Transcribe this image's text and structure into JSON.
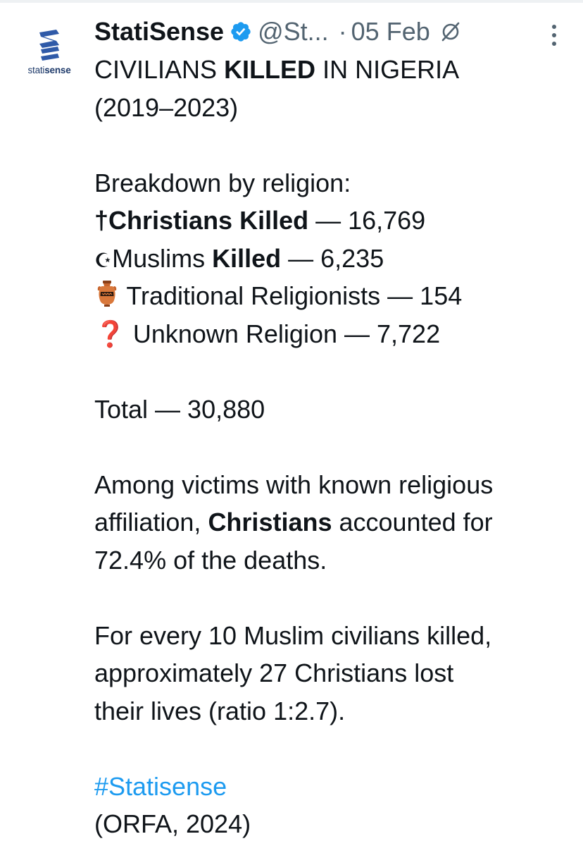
{
  "author": {
    "avatar_brand": "statisense",
    "avatar_brand_prefix": "stati",
    "avatar_brand_suffix": "sense",
    "name": "StatiSense",
    "handle": "@St...",
    "date": "05 Feb",
    "verified_icon": "verified-badge-icon",
    "grok_icon": "grok-icon",
    "more_icon": "more-vertical-icon"
  },
  "tweet": {
    "title_pre": "CIVILIANS ",
    "title_bold": "KILLED",
    "title_post": " IN NIGERIA",
    "years": "(2019–2023)",
    "breakdown_heading": "Breakdown by religion:",
    "items": [
      {
        "icon": "cross-icon",
        "glyph": "†",
        "bold": "Christians Killed",
        "text": " — 16,769"
      },
      {
        "icon": "crescent-icon",
        "glyph": "☪",
        "plain": "Muslims ",
        "bold": "Killed",
        "text": " — 6,235"
      },
      {
        "icon": "amphora-icon",
        "text": " Traditional Religionists — 154"
      },
      {
        "icon": "red-question-icon",
        "glyph": "❓",
        "text": " Unknown Religion — 7,722"
      }
    ],
    "total": "Total — 30,880",
    "para1_l1": "Among victims with known religious",
    "para1_l2_pre": "affiliation, ",
    "para1_l2_bold": "Christians",
    "para1_l2_post": " accounted for",
    "para1_l3": "72.4% of the deaths.",
    "para2_l1": "For every 10 Muslim civilians killed,",
    "para2_l2": "approximately 27 Christians lost",
    "para2_l3": "their lives (ratio 1:2.7).",
    "hashtag": "#Statisense",
    "source": "(ORFA, 2024)"
  },
  "colors": {
    "text": "#0f1419",
    "secondary": "#536471",
    "link": "#1d9bf0",
    "verified": "#1d9bf0",
    "brand_blue": "#2f5aa8"
  }
}
